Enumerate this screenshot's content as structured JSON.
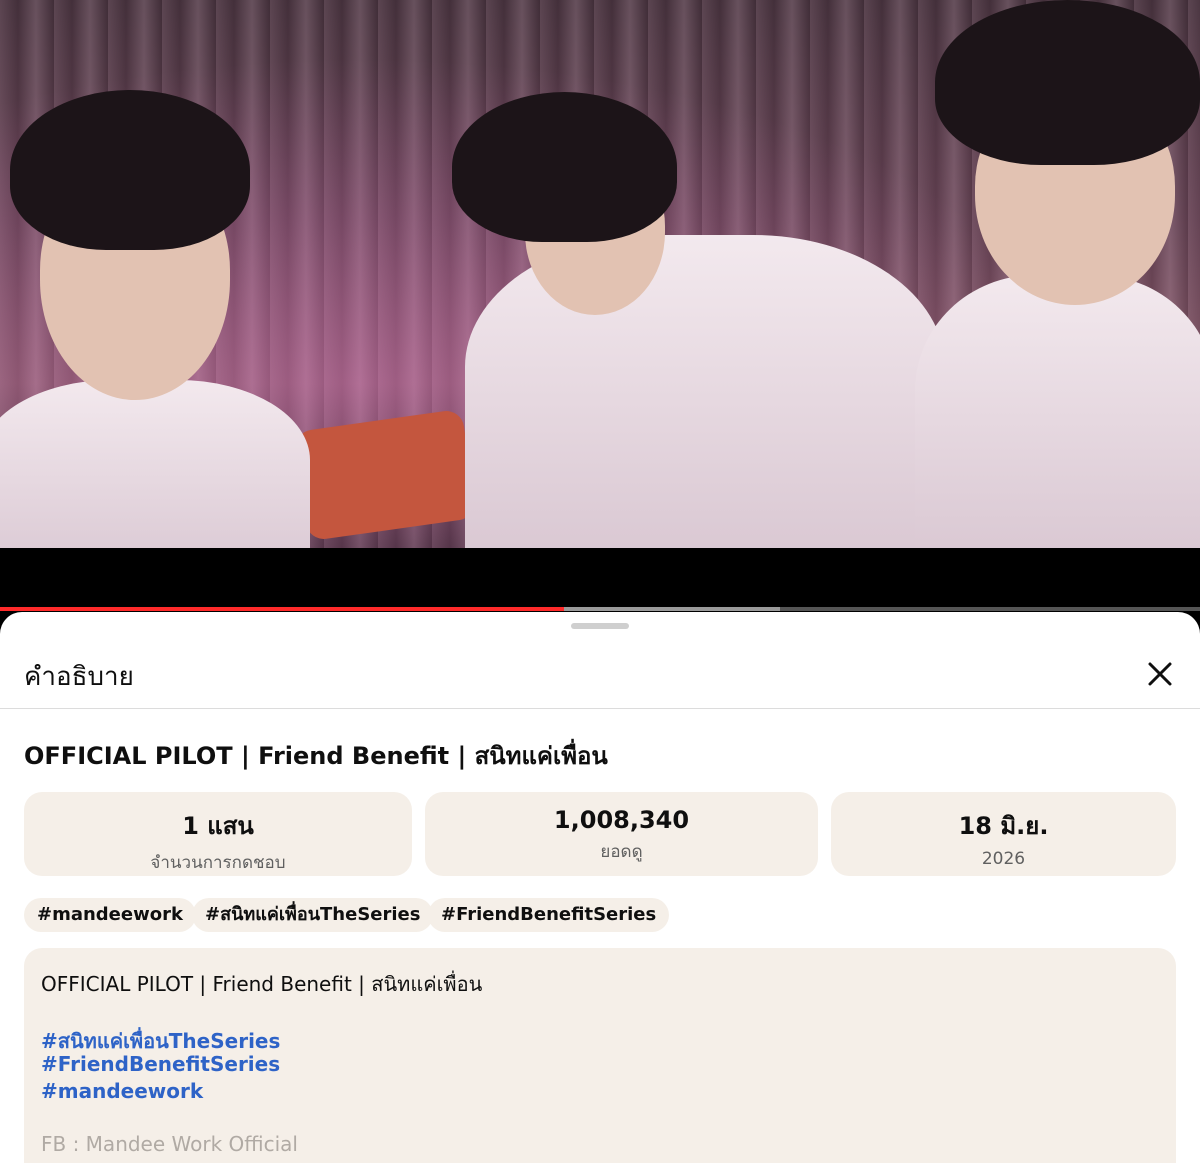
{
  "video": {
    "description": "",
    "progress_fraction": 0.47,
    "buffer_fraction": 0.65
  },
  "sheet": {
    "title": "คำอธิบาย",
    "close_icon": "close-icon"
  },
  "video_title": "OFFICIAL PILOT | Friend Benefit | สนิทแค่เพื่อน",
  "stats": {
    "likes_value": "1 แสน",
    "likes_label": "จำนวนการกดชอบ",
    "views_value": "1,008,340",
    "views_label": "ยอดดู",
    "date_value": "18 มิ.ย.",
    "date_year": "2026"
  },
  "chips": [
    "#mandeework",
    "#สนิทแค่เพื่อนTheSeries",
    "#FriendBenefitSeries"
  ],
  "description": {
    "first_line": "OFFICIAL PILOT | Friend Benefit | สนิทแค่เพื่อน",
    "hashtags": [
      "#สนิทแค่เพื่อนTheSeries",
      "#FriendBenefitSeries",
      "#mandeework"
    ],
    "fb_line": "FB : Mandee Work Official"
  },
  "colors": {
    "accent_progress": "#ff2a2a",
    "hashtag_link": "#2e63c7",
    "card_bg": "#f5efe8"
  }
}
